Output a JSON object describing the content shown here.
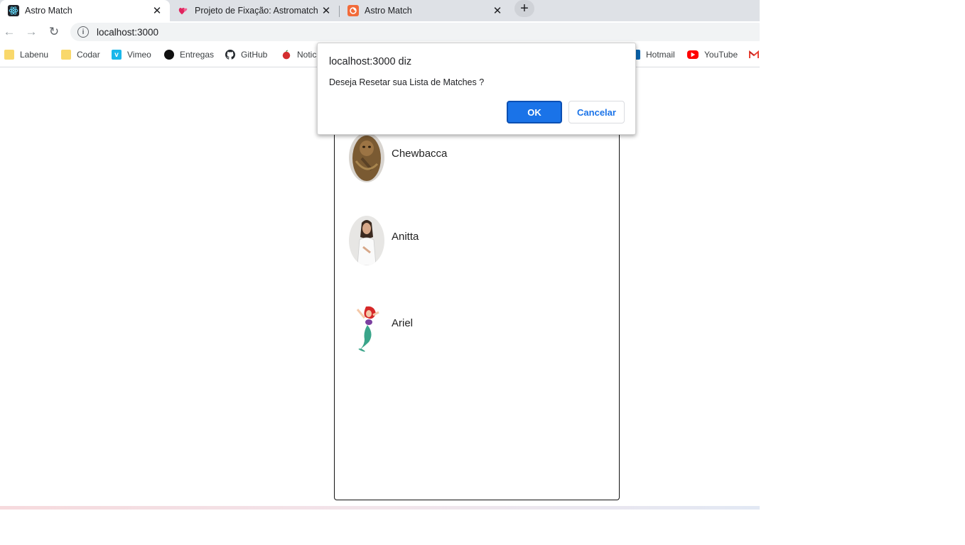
{
  "browser": {
    "tabs": [
      {
        "title": "Astro Match",
        "active": true,
        "icon": "react-icon"
      },
      {
        "title": "Projeto de Fixação: Astromatch",
        "active": false,
        "icon": "hearts-icon"
      },
      {
        "title": "Astro Match",
        "active": false,
        "icon": "astromatch-logo-icon"
      }
    ],
    "url": "localhost:3000",
    "bookmarks": [
      {
        "label": "Labenu",
        "icon": "folder-icon"
      },
      {
        "label": "Codar",
        "icon": "folder-icon"
      },
      {
        "label": "Vimeo",
        "icon": "vimeo-icon"
      },
      {
        "label": "Entregas",
        "icon": "circle-icon"
      },
      {
        "label": "GitHub",
        "icon": "github-icon"
      },
      {
        "label": "Notic",
        "icon": "apple-icon"
      },
      {
        "label": "Hotmail",
        "icon": "outlook-icon"
      },
      {
        "label": "YouTube",
        "icon": "youtube-icon"
      }
    ]
  },
  "matches": [
    {
      "name": "Chewbacca"
    },
    {
      "name": "Anitta"
    },
    {
      "name": "Ariel"
    }
  ],
  "dialog": {
    "title": "localhost:3000 diz",
    "message": "Deseja Resetar sua Lista de Matches ?",
    "ok_label": "OK",
    "cancel_label": "Cancelar"
  },
  "colors": {
    "accent": "#1a73e8",
    "tabstrip": "#dee1e6",
    "card_border": "#111111"
  }
}
